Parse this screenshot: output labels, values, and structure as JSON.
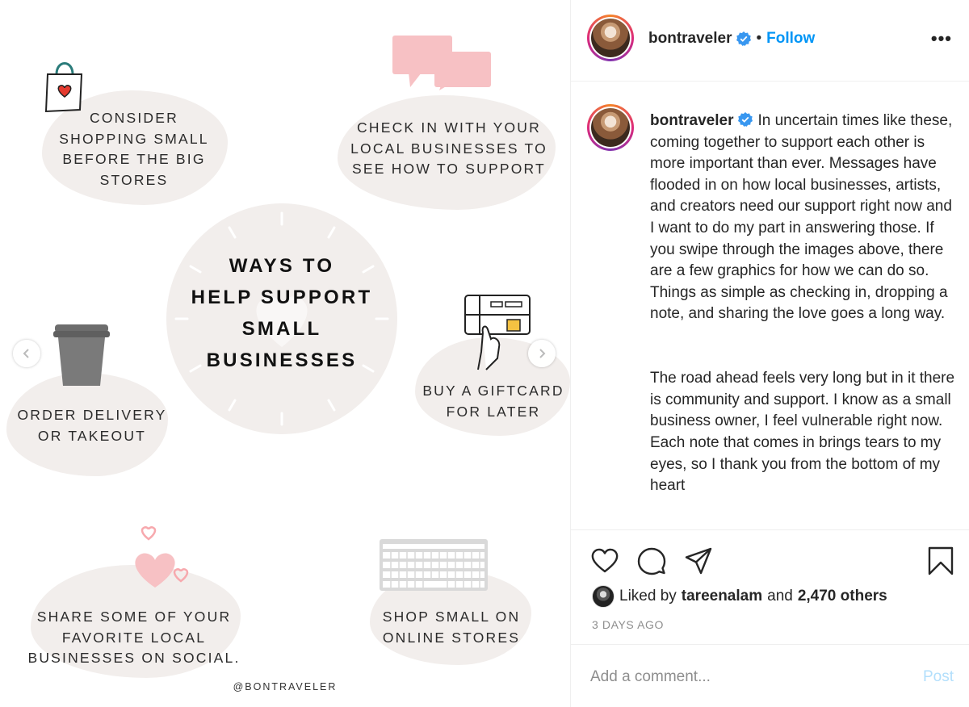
{
  "graphic": {
    "title_lines": [
      "WAYS TO",
      "HELP SUPPORT",
      "SMALL",
      "BUSINESSES"
    ],
    "tips": [
      {
        "lines": [
          "CONSIDER",
          "SHOPPING SMALL",
          "BEFORE THE BIG",
          "STORES"
        ],
        "icon": "shopping-bag-icon"
      },
      {
        "lines": [
          "CHECK IN WITH YOUR",
          "LOCAL BUSINESSES TO",
          "SEE HOW TO SUPPORT"
        ],
        "icon": "chat-bubbles-icon"
      },
      {
        "lines": [
          "ORDER DELIVERY",
          "OR TAKEOUT"
        ],
        "icon": "coffee-cup-icon"
      },
      {
        "lines": [
          "BUY A GIFTCARD",
          "FOR LATER"
        ],
        "icon": "giftcard-icon"
      },
      {
        "lines": [
          "SHARE SOME OF YOUR",
          "FAVORITE LOCAL",
          "BUSINESSES ON SOCIAL."
        ],
        "icon": "hearts-icon"
      },
      {
        "lines": [
          "SHOP SMALL ON",
          "ONLINE STORES"
        ],
        "icon": "keyboard-icon"
      }
    ],
    "watermark": "@BONTRAVELER"
  },
  "post": {
    "username": "bontraveler",
    "follow_label": "Follow",
    "more_label": "•••",
    "caption_paragraphs": [
      "In uncertain times like these, coming together to support each other is more important than ever. Messages have flooded in on how local businesses, artists, and creators need our support right now and I want to do my part in answering those. If you swipe through the images above, there are a few graphics for how we can do so. Things as simple as checking in, dropping a note, and sharing the love goes a long way.",
      "The road ahead feels very long but in it there is community and support. I know as a small business owner, I feel vulnerable right now. Each note that comes in brings tears to my eyes, so I thank you from the bottom of my heart"
    ],
    "liked_prefix": "Liked by",
    "liked_user": "tareenalam",
    "liked_and": "and",
    "liked_others": "2,470 others",
    "timestamp": "3 DAYS AGO",
    "comment_placeholder": "Add a comment...",
    "post_label": "Post"
  },
  "colors": {
    "link_blue": "#0095f6",
    "post_disabled": "#b2dffc",
    "verified_blue": "#3897f0",
    "blob": "#f2eeec",
    "pink": "#f7c1c4"
  }
}
